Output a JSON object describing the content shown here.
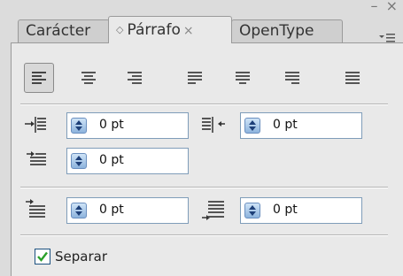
{
  "window": {
    "buttons": "– ×"
  },
  "tabs": [
    {
      "label": "Carácter",
      "active": false
    },
    {
      "label": "Párrafo",
      "active": true,
      "close": "×"
    },
    {
      "label": "OpenType",
      "active": false
    }
  ],
  "alignment": {
    "buttons": [
      {
        "name": "align-left",
        "selected": true
      },
      {
        "name": "align-center",
        "selected": false
      },
      {
        "name": "align-right",
        "selected": false
      },
      {
        "name": "justify-last-left",
        "selected": false
      },
      {
        "name": "justify-last-center",
        "selected": false
      },
      {
        "name": "justify-last-right",
        "selected": false
      },
      {
        "name": "justify-all",
        "selected": false
      }
    ]
  },
  "indents": {
    "left": {
      "value": "0 pt",
      "icon": "left-indent-icon"
    },
    "right": {
      "value": "0 pt",
      "icon": "right-indent-icon"
    },
    "first_line": {
      "value": "0 pt",
      "icon": "first-line-indent-icon"
    }
  },
  "spacing": {
    "before": {
      "value": "0 pt",
      "icon": "space-before-icon"
    },
    "after": {
      "value": "0 pt",
      "icon": "space-after-icon"
    }
  },
  "hyphenate": {
    "label": "Separar",
    "checked": true
  }
}
